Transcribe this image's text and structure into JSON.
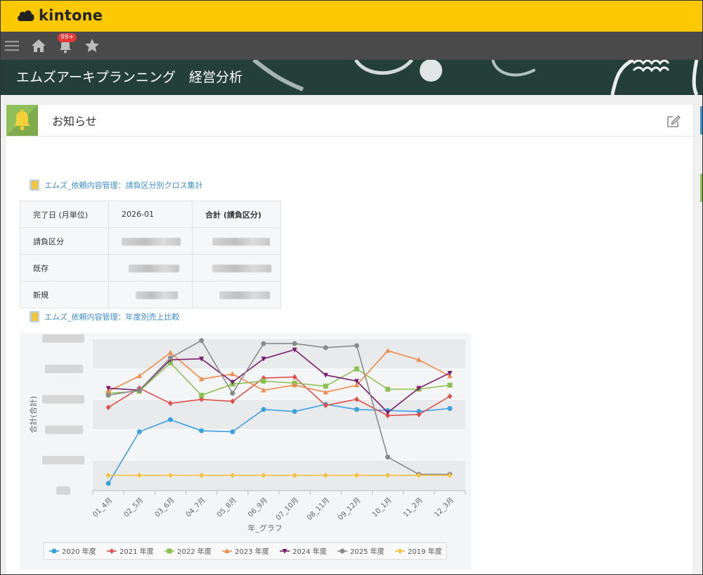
{
  "app": {
    "logo_text": "kintone"
  },
  "nav": {
    "notification_count": "99+"
  },
  "space": {
    "title": "エムズアーキプランニング　経営分析"
  },
  "panel": {
    "title": "お知らせ"
  },
  "reports": [
    {
      "title": "エムズ_依頼内容管理：請負区分別クロス集計"
    },
    {
      "title": "エムズ_依頼内容管理：年度別売上比較"
    }
  ],
  "crosstab": {
    "header": [
      "完了日 (月単位)",
      "2026-01",
      "合計 (請負区分)"
    ],
    "rows": [
      {
        "label": "請負区分"
      },
      {
        "label": "既存"
      },
      {
        "label": "新規"
      }
    ]
  },
  "chart_data": {
    "type": "line",
    "xlabel": "年_グラフ",
    "ylabel": "合計(合計)",
    "categories": [
      "01_4月",
      "02_5月",
      "03_6月",
      "04_7月",
      "05_8月",
      "06_9月",
      "07_10月",
      "08_11月",
      "09_12月",
      "10_1月",
      "11_2月",
      "12_3月"
    ],
    "y_tick_labels_hidden": true,
    "grid": true,
    "legend": "bottom",
    "series": [
      {
        "name": "2020 年度",
        "color": "#3aa0e0",
        "marker": "circle",
        "values": [
          0.7,
          5.8,
          7.0,
          5.9,
          5.8,
          8.0,
          7.8,
          8.5,
          8.0,
          7.9,
          7.8,
          8.1
        ]
      },
      {
        "name": "2021 年度",
        "color": "#e0504a",
        "marker": "diamond",
        "values": [
          8.2,
          10.1,
          8.6,
          9.0,
          8.8,
          11.1,
          11.2,
          8.4,
          9.0,
          7.4,
          7.5,
          9.3
        ]
      },
      {
        "name": "2022 年度",
        "color": "#8cc152",
        "marker": "square",
        "values": [
          9.6,
          9.8,
          12.6,
          9.4,
          10.5,
          10.8,
          10.6,
          10.3,
          12.0,
          10.0,
          10.0,
          10.4
        ]
      },
      {
        "name": "2023 年度",
        "color": "#f0894a",
        "marker": "triangle",
        "values": [
          9.8,
          11.3,
          13.6,
          11.0,
          11.5,
          9.9,
          10.4,
          9.7,
          10.4,
          13.8,
          12.9,
          11.3
        ]
      },
      {
        "name": "2024 年度",
        "color": "#7a1f6f",
        "marker": "tri-down",
        "values": [
          10.1,
          9.9,
          12.9,
          13.0,
          10.7,
          13.0,
          13.9,
          11.4,
          10.8,
          7.7,
          10.1,
          11.6
        ]
      },
      {
        "name": "2025 年度",
        "color": "#8a8a8a",
        "marker": "circle",
        "values": [
          9.4,
          9.9,
          13.1,
          14.8,
          9.6,
          14.5,
          14.5,
          14.1,
          14.3,
          3.3,
          1.6,
          1.6
        ]
      },
      {
        "name": "2019 年度",
        "color": "#f5c242",
        "marker": "diamond",
        "values": [
          1.5,
          1.5,
          1.5,
          1.5,
          1.5,
          1.5,
          1.5,
          1.5,
          1.5,
          1.5,
          1.5,
          1.5
        ]
      }
    ]
  }
}
